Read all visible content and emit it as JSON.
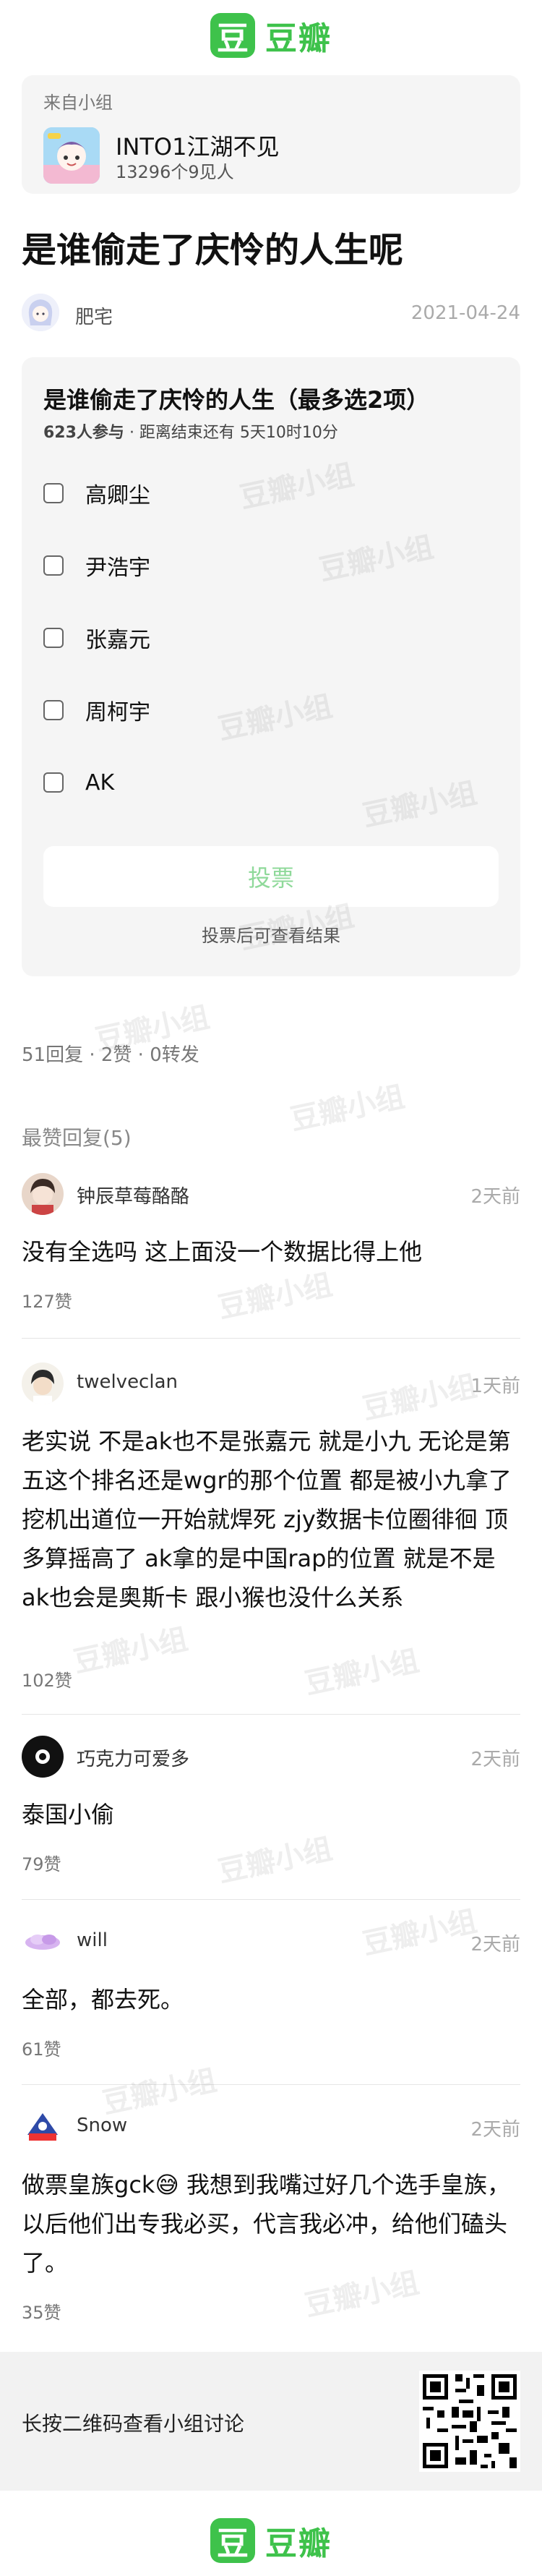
{
  "brand": {
    "logo_glyph": "豆",
    "name": "豆瓣",
    "color": "#3ec24b"
  },
  "group": {
    "from_label": "来自小组",
    "name": "INTO1江湖不见",
    "members": "13296个9见人"
  },
  "post": {
    "title": "是谁偷走了庆怜的人生呢",
    "author": "肥宅",
    "date": "2021-04-24"
  },
  "poll": {
    "title": "是谁偷走了庆怜的人生（最多选",
    "title_count": "2",
    "title_suffix": "项）",
    "participants": "623人参与",
    "deadline": "· 距离结束还有 5天10时10分",
    "options": [
      "高卿尘",
      "尹浩宇",
      "张嘉元",
      "周柯宇",
      "AK"
    ],
    "vote_label": "投票",
    "hint": "投票后可查看结果"
  },
  "stats": "51回复 · 2赞 · 0转发",
  "comments_header": "最赞回复(5)",
  "comments": [
    {
      "name": "钟辰草莓酪酪",
      "time": "2天前",
      "text": "没有全选吗 这上面没一个数据比得上他",
      "likes": "127赞"
    },
    {
      "name": "twelveclan",
      "time": "1天前",
      "text": "老实说 不是ak也不是张嘉元 就是小九 无论是第五这个排名还是wgr的那个位置 都是被小九拿了 挖机出道位一开始就焊死 zjy数据卡位圈徘徊 顶多算摇高了 ak拿的是中国rap的位置 就是不是ak也会是奥斯卡 跟小猴也没什么关系",
      "likes": "102赞"
    },
    {
      "name": "巧克力可爱多",
      "time": "2天前",
      "text": "泰国小偷",
      "likes": "79赞"
    },
    {
      "name": "will",
      "time": "2天前",
      "text": "全部，都去死。",
      "likes": "61赞"
    },
    {
      "name": "Snow",
      "time": "2天前",
      "text": "做票皇族gck😅 我想到我嘴过好几个选手皇族，以后他们出专我必买，代言我必冲，给他们磕头了。",
      "likes": "35赞"
    }
  ],
  "footer": {
    "qr_text": "长按二维码查看小组讨论"
  },
  "watermark": "豆瓣小组"
}
